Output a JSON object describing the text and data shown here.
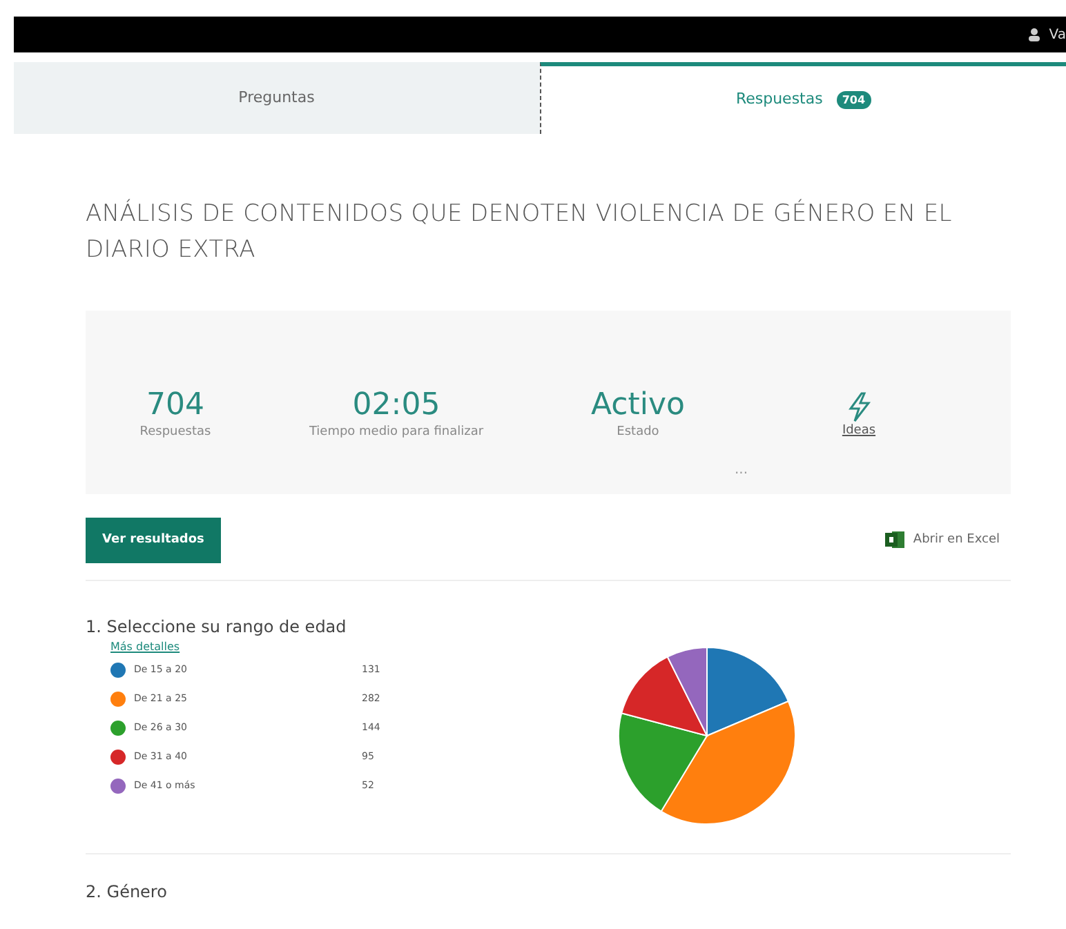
{
  "top_bar": {
    "user_text": "Va"
  },
  "tabs": [
    {
      "label": "Preguntas",
      "selected": false
    },
    {
      "label": "Respuestas",
      "badge": "704",
      "selected": true
    }
  ],
  "title": "ANÁLISIS DE CONTENIDOS QUE DENOTEN VIOLENCIA DE GÉNERO EN EL DIARIO EXTRA",
  "stats": [
    {
      "value": "704",
      "label": "Respuestas"
    },
    {
      "value": "02:05",
      "label": "Tiempo medio para finalizar"
    },
    {
      "value": "Activo",
      "label": "Estado"
    }
  ],
  "ideas": {
    "label": "Ideas"
  },
  "more": "...",
  "actions": {
    "view_results": "Ver resultados",
    "open_excel": "Abrir en Excel"
  },
  "questions": [
    {
      "number": "1.",
      "text": "Seleccione su rango de edad",
      "details_link": "Más detalles",
      "options": [
        {
          "color": "#1f77b4"
        },
        {
          "color": "#ff7f0e"
        },
        {
          "color": "#2ca02c"
        },
        {
          "color": "#d62728"
        },
        {
          "color": "#9467bd"
        }
      ],
      "chart_data": {
        "type": "pie",
        "categories": [
          "De 15 a 20",
          "De 21 a 25",
          "De 26 a 30",
          "De 31 a 40",
          "De 41 o más"
        ],
        "values": [
          131,
          282,
          144,
          95,
          52
        ],
        "value_labels": [
          "131",
          "282",
          "144",
          "95",
          "52"
        ],
        "legend": "left"
      }
    },
    {
      "number": "2.",
      "text": "Género"
    }
  ]
}
